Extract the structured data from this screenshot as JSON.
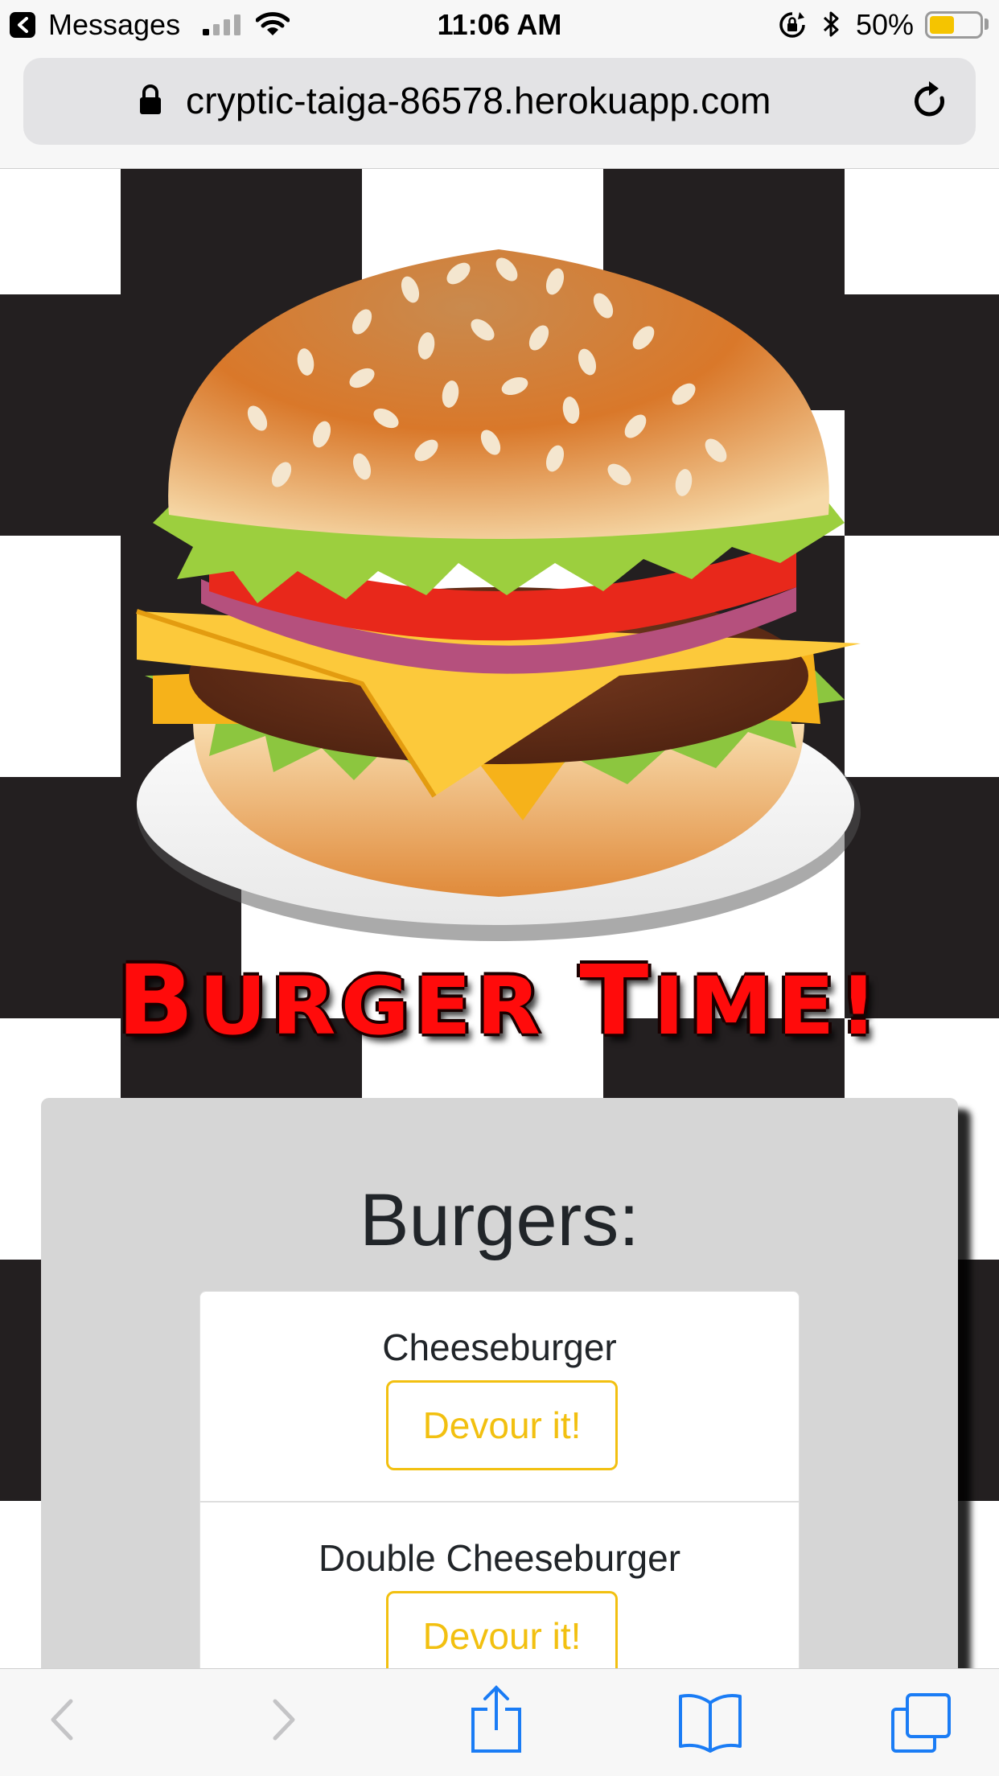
{
  "status_bar": {
    "back_app": "Messages",
    "time": "11:06 AM",
    "battery_percent": "50%",
    "battery_level": 0.5,
    "icons": [
      "back-arrow-icon",
      "cell-signal-icon",
      "wifi-icon",
      "rotation-lock-icon",
      "bluetooth-icon",
      "battery-icon"
    ]
  },
  "address_bar": {
    "url": "cryptic-taiga-86578.herokuapp.com",
    "icons": [
      "lock-icon",
      "reload-icon"
    ]
  },
  "page": {
    "brand_title": {
      "first_B": "B",
      "first_rest": "URGER",
      "second_T": "T",
      "second_rest": "IME!"
    },
    "heading": "Burgers:",
    "burgers": [
      {
        "name": "Cheeseburger",
        "button": "Devour it!"
      },
      {
        "name": "Double Cheeseburger",
        "button": "Devour it!"
      }
    ]
  },
  "toolbar": {
    "icons": [
      "back-icon",
      "forward-icon",
      "share-icon",
      "bookmarks-icon",
      "tabs-icon"
    ]
  },
  "colors": {
    "accent": "#f2c010",
    "title_red": "#ff0b0b",
    "panel_gray": "#d6d6d6",
    "checker_dark": "#231f20",
    "ios_blue": "#1a7cf5"
  }
}
